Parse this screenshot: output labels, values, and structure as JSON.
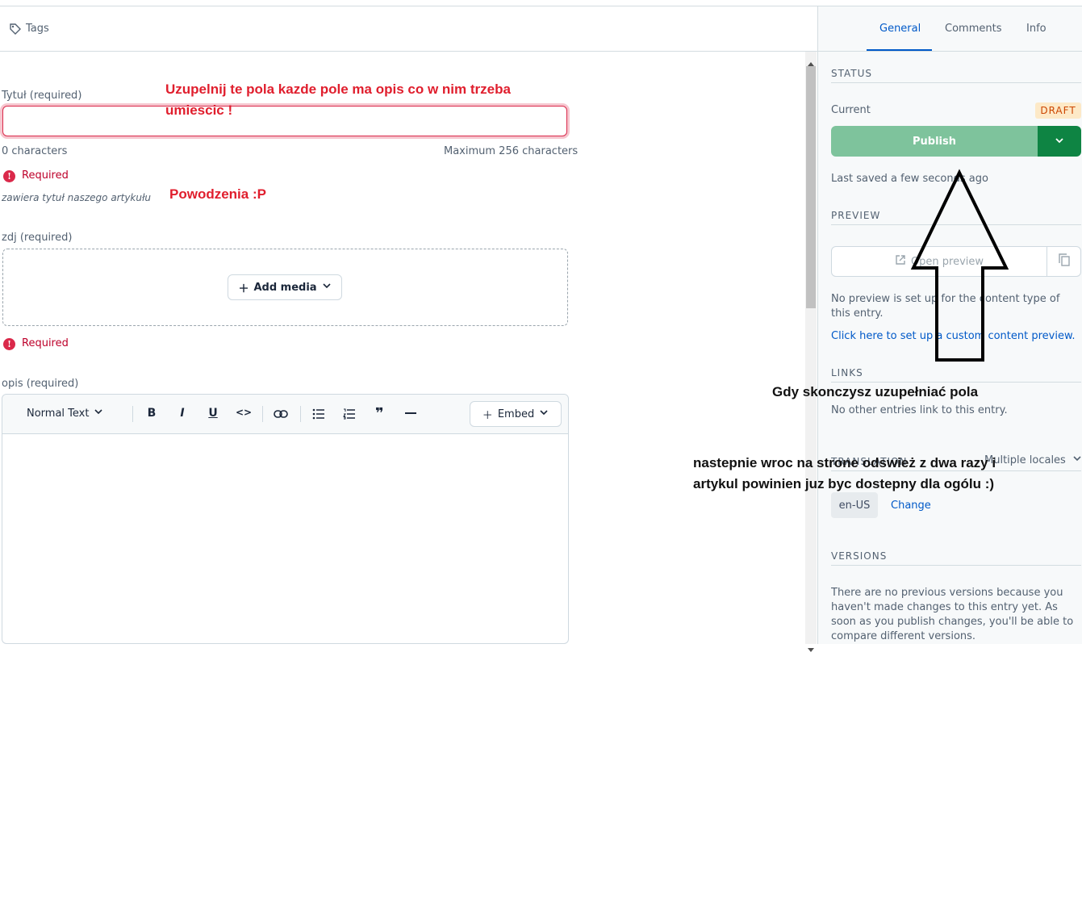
{
  "tags": {
    "icon": "tag-icon",
    "label": "Tags"
  },
  "annotations": {
    "fill_fields": "Uzupelnij te pola kazde pole ma opis co w nim trzeba umiescic !",
    "good_luck": "Powodzenia :P",
    "when_done": "Gdy skonczysz uzupełniać pola",
    "then_return": "nastepnie wroc na strone odswież z dwa razy i artykul powinien juz byc dostepny dla ogólu :)"
  },
  "fields": {
    "title": {
      "label": "Tytuł (required)",
      "value": "",
      "char_count": "0 characters",
      "max": "Maximum 256 characters",
      "error": "Required",
      "hint": "zawiera tytuł naszego artykułu"
    },
    "image": {
      "label": "zdj (required)",
      "add_media": "Add media",
      "error": "Required"
    },
    "description": {
      "label": "opis (required)",
      "toolbar": {
        "text_style": "Normal Text",
        "bold": "B",
        "italic": "I",
        "underline": "U",
        "code": "<>",
        "embed": "Embed"
      }
    }
  },
  "sidebar": {
    "tabs": [
      {
        "label": "General",
        "active": true
      },
      {
        "label": "Comments",
        "active": false
      },
      {
        "label": "Info",
        "active": false
      }
    ],
    "status": {
      "heading": "STATUS",
      "current_label": "Current",
      "badge": "DRAFT",
      "publish": "Publish",
      "last_saved": "Last saved a few seconds ago"
    },
    "preview": {
      "heading": "PREVIEW",
      "open_preview": "Open preview",
      "no_preview": "No preview is set up for the content type of this entry.",
      "setup_link": "Click here to set up a custom content preview."
    },
    "links": {
      "heading": "LINKS",
      "text": "No other entries link to this entry."
    },
    "translation": {
      "heading": "TRANSLATION",
      "dropdown": "Multiple locales",
      "locale": "en-US",
      "change": "Change"
    },
    "versions": {
      "heading": "VERSIONS",
      "text": "There are no previous versions because you haven't made changes to this entry yet. As soon as you publish changes, you'll be able to compare different versions."
    }
  },
  "colors": {
    "accent": "#0059c8",
    "publish": "#7ec39c",
    "publish_dark": "#0e8443",
    "error": "#da294a",
    "annotation_red": "#e01e2d"
  }
}
